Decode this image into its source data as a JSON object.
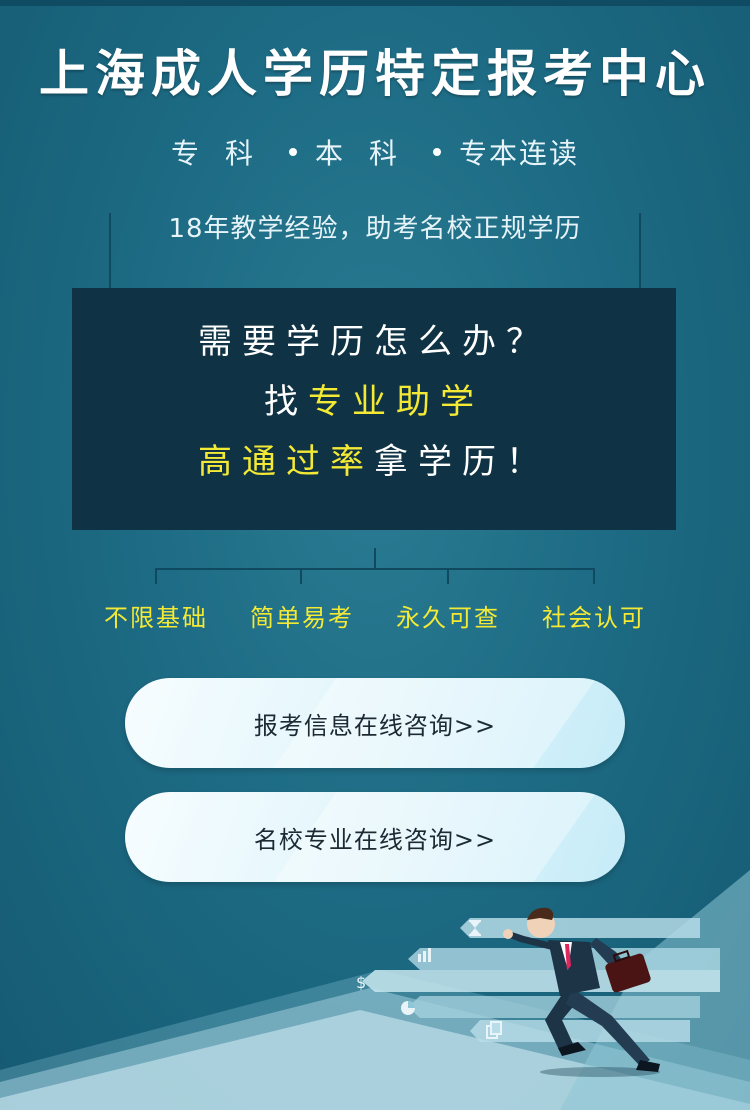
{
  "header": {
    "title": "上海成人学历特定报考中心",
    "subtitle_a": "专科",
    "subtitle_b": "本科",
    "subtitle_c": "专本连读",
    "tagline": "18年教学经验，助考名校正规学历"
  },
  "headline": {
    "line1": "需要学历怎么办？",
    "line2_prefix": "找",
    "line2_highlight": "专业助学",
    "line3_highlight": "高通过率",
    "line3_suffix": "拿学历！"
  },
  "features": [
    "不限基础",
    "简单易考",
    "永久可查",
    "社会认可"
  ],
  "buttons": {
    "consult_info": "报考信息在线咨询>>",
    "consult_school": "名校专业在线咨询>>"
  },
  "colors": {
    "background": "#1d6b84",
    "accent_yellow": "#f4e935",
    "dark_box": "#0f3344",
    "button_light": "#dff4fb"
  },
  "illustration": {
    "icons": [
      "hourglass-icon",
      "bar-chart-icon",
      "dollar-icon",
      "pie-chart-icon",
      "document-icon"
    ],
    "figure": "running-businessman-with-briefcase"
  }
}
